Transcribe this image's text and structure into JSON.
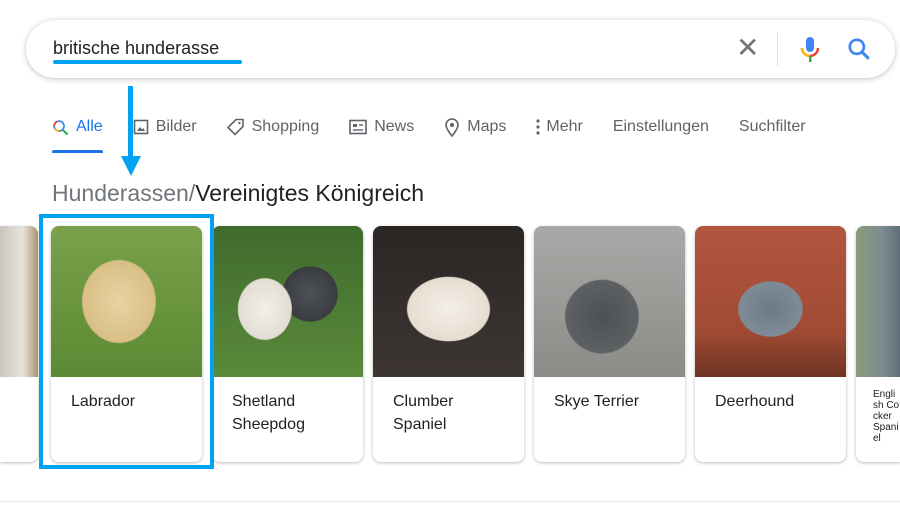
{
  "search": {
    "query": "britische hunderasse",
    "clear_icon": "close-icon",
    "mic_icon": "microphone-icon",
    "search_icon": "search-icon"
  },
  "tabs": [
    {
      "label": "Alle",
      "icon": "search-icon",
      "active": true
    },
    {
      "label": "Bilder",
      "icon": "image-icon"
    },
    {
      "label": "Shopping",
      "icon": "tag-icon"
    },
    {
      "label": "News",
      "icon": "newspaper-icon"
    },
    {
      "label": "Maps",
      "icon": "map-pin-icon"
    },
    {
      "label": "Mehr",
      "icon": "more-vert-icon"
    },
    {
      "label": "Einstellungen"
    },
    {
      "label": "Suchfilter"
    }
  ],
  "breadcrumb": {
    "parent": "Hunderassen",
    "separator": "/",
    "current": "Vereinigtes Königreich"
  },
  "cards": [
    {
      "label": ""
    },
    {
      "label": "Labrador"
    },
    {
      "label": "Shetland Sheepdog"
    },
    {
      "label": "Clumber Spaniel"
    },
    {
      "label": "Skye Terrier"
    },
    {
      "label": "Deerhound"
    },
    {
      "label": "English Cocker Spaniel"
    }
  ],
  "annotation_color": "#00a2f3",
  "accent": "#1a73e8"
}
